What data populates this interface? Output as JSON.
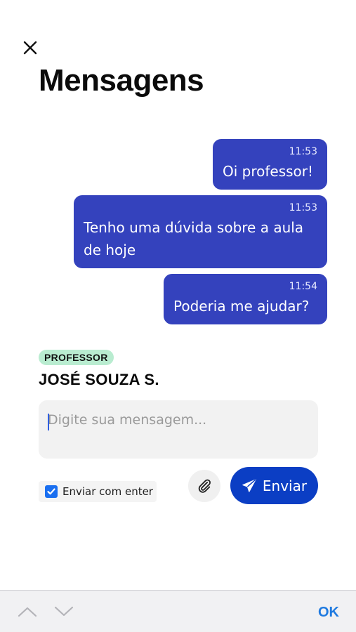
{
  "page": {
    "title": "Mensagens"
  },
  "messages": [
    {
      "time": "11:53",
      "text": "Oi professor!"
    },
    {
      "time": "11:53",
      "text": "Tenho uma dúvida sobre a aula de hoje"
    },
    {
      "time": "11:54",
      "text": "Poderia me ajudar?"
    }
  ],
  "recipient": {
    "role_badge": "PROFESSOR",
    "name": "JOSÉ SOUZA S."
  },
  "composer": {
    "placeholder": "Digite sua mensagem...",
    "value": "",
    "send_with_enter_label": "Enviar com enter",
    "send_with_enter_checked": true,
    "send_label": "Enviar"
  },
  "keyboard_bar": {
    "ok_label": "OK"
  },
  "icons": {
    "close": "close-icon",
    "attach": "paperclip-icon",
    "send": "paper-plane-icon",
    "check": "checkmark-icon",
    "prev": "chevron-up-icon",
    "next": "chevron-down-icon"
  },
  "colors": {
    "bubble": "#3442bd",
    "send_button": "#0b3ec4",
    "badge": "#b9ecd0",
    "accent": "#1f7ae0"
  }
}
